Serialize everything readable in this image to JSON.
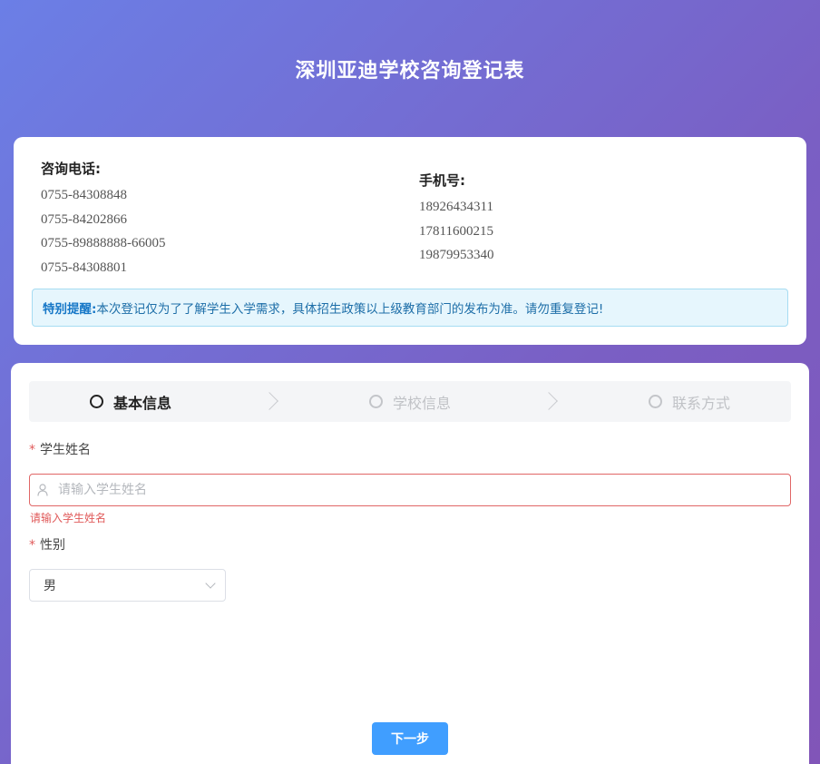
{
  "page": {
    "title": "深圳亚迪学校咨询登记表"
  },
  "contact": {
    "phone_label": "咨询电话:",
    "phones": [
      "0755-84308848",
      "0755-84202866",
      "0755-89888888-66005",
      "0755-84308801"
    ],
    "mobile_label": "手机号:",
    "mobiles": [
      "18926434311",
      "17811600215",
      "19879953340"
    ]
  },
  "notice": {
    "label": "特别提醒:",
    "text": "本次登记仅为了了解学生入学需求，具体招生政策以上级教育部门的发布为准。请勿重复登记!"
  },
  "steps": [
    {
      "label": "基本信息",
      "state": "active"
    },
    {
      "label": "学校信息",
      "state": "inactive"
    },
    {
      "label": "联系方式",
      "state": "inactive"
    }
  ],
  "form": {
    "required_mark": "*",
    "name_label": "学生姓名",
    "name_placeholder": "请输入学生姓名",
    "name_value": "",
    "name_error": "请输入学生姓名",
    "gender_label": "性别",
    "gender_value": "男",
    "next_label": "下一步"
  },
  "colors": {
    "accent": "#409eff",
    "error": "#e05a5a",
    "notice_bg": "#e6f6fd",
    "bg_gradient_start": "#6b7fe6",
    "bg_gradient_end": "#8155b8"
  }
}
